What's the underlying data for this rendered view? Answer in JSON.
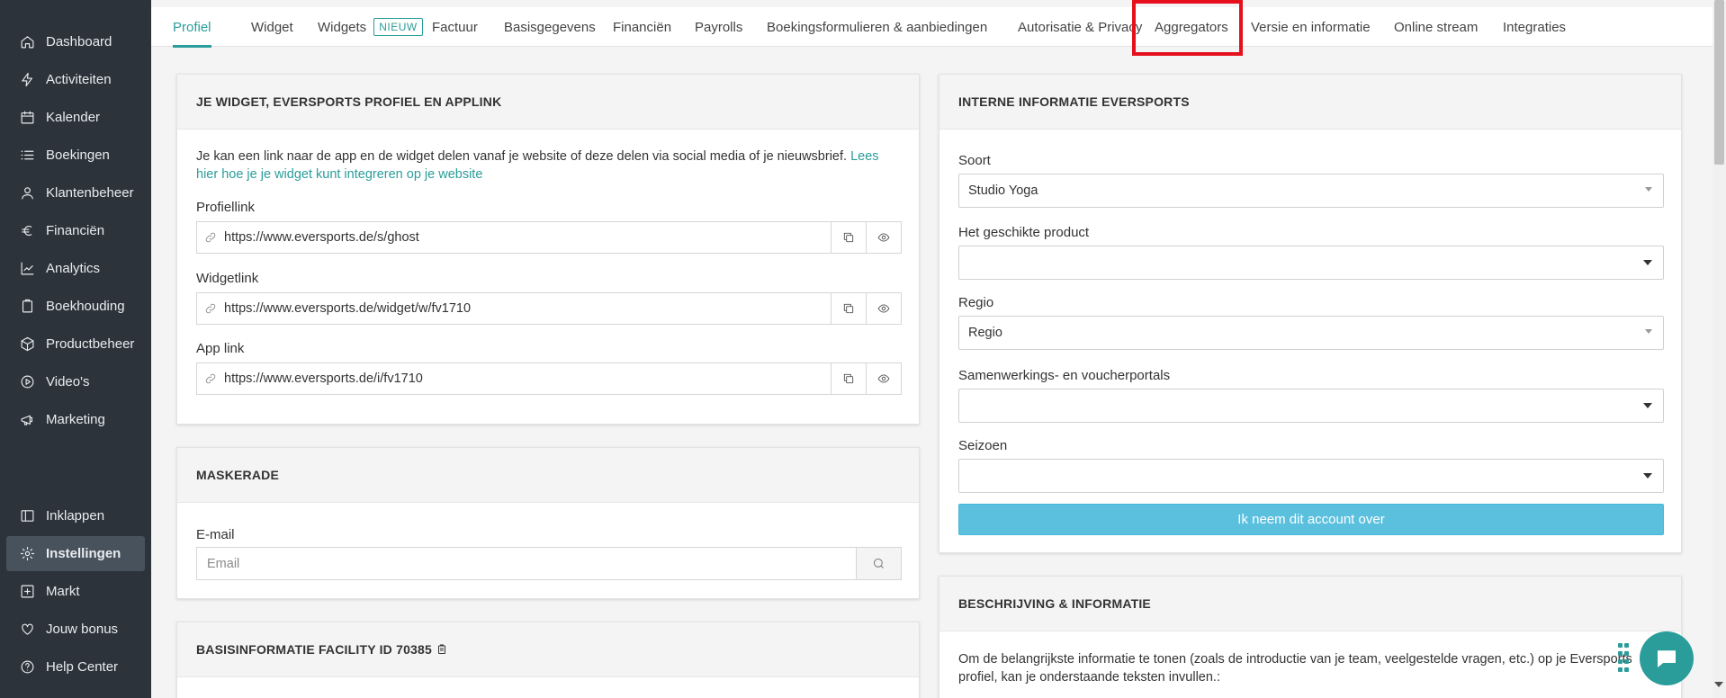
{
  "sidebar": {
    "items": [
      {
        "label": "Dashboard",
        "icon": "home-icon"
      },
      {
        "label": "Activiteiten",
        "icon": "bolt-icon"
      },
      {
        "label": "Kalender",
        "icon": "calendar-icon"
      },
      {
        "label": "Boekingen",
        "icon": "list-icon"
      },
      {
        "label": "Klantenbeheer",
        "icon": "user-icon"
      },
      {
        "label": "Financiën",
        "icon": "euro-icon"
      },
      {
        "label": "Analytics",
        "icon": "chart-line-icon"
      },
      {
        "label": "Boekhouding",
        "icon": "clipboard-icon"
      },
      {
        "label": "Productbeheer",
        "icon": "box-icon"
      },
      {
        "label": "Video's",
        "icon": "play-circle-icon"
      },
      {
        "label": "Marketing",
        "icon": "megaphone-icon"
      }
    ],
    "bottom_items": [
      {
        "label": "Inklappen",
        "icon": "collapse-icon"
      },
      {
        "label": "Instellingen",
        "icon": "gear-icon",
        "active": true
      },
      {
        "label": "Markt",
        "icon": "plus-square-icon"
      },
      {
        "label": "Jouw bonus",
        "icon": "heart-icon"
      },
      {
        "label": "Help Center",
        "icon": "help-circle-icon"
      }
    ]
  },
  "tabs": [
    {
      "label": "Profiel",
      "active": true
    },
    {
      "label": "Widget"
    },
    {
      "label": "Widgets",
      "badge": "NIEUW"
    },
    {
      "label": "Factuur"
    },
    {
      "label": "Basisgegevens"
    },
    {
      "label": "Financiën"
    },
    {
      "label": "Payrolls"
    },
    {
      "label": "Boekingsformulieren & aanbiedingen"
    },
    {
      "label": "Autorisatie & Privacy"
    },
    {
      "label": "Aggregators",
      "highlighted": true
    },
    {
      "label": "Versie en informatie"
    },
    {
      "label": "Online stream"
    },
    {
      "label": "Integraties"
    }
  ],
  "widget_card": {
    "title": "JE WIDGET, EVERSPORTS PROFIEL EN APPLINK",
    "description": "Je kan een link naar de app en de widget delen vanaf je website of deze delen via social media of je nieuwsbrief.",
    "description_link_part1": "Lees",
    "description_link_part2": "hier hoe je je widget kunt integreren op je website",
    "profile_label": "Profiellink",
    "profile_url": "https://www.eversports.de/s/ghost",
    "widget_label": "Widgetlink",
    "widget_url": "https://www.eversports.de/widget/w/fv1710",
    "app_label": "App link",
    "app_url": "https://www.eversports.de/i/fv1710"
  },
  "masquerade_card": {
    "title": "MASKERADE",
    "email_label": "E-mail",
    "email_placeholder": "Email"
  },
  "basic_info_card": {
    "title": "BASISINFORMATIE FACILITY ID 70385"
  },
  "internal_card": {
    "title": "INTERNE INFORMATIE EVERSPORTS",
    "type_label": "Soort",
    "type_value": "Studio Yoga",
    "product_label": "Het geschikte product",
    "product_value": "",
    "region_label": "Regio",
    "region_value": "Regio",
    "portals_label": "Samenwerkings- en voucherportals",
    "portals_value": "",
    "season_label": "Seizoen",
    "season_value": "",
    "takeover_button": "Ik neem dit account over"
  },
  "description_card": {
    "title": "BESCHRIJVING & INFORMATIE",
    "line1": "Om de belangrijkste informatie te tonen (zoals de introductie van je team, veelgestelde vragen, etc.) op je Eversports",
    "line2": "profiel, kan je onderstaande teksten invullen.:"
  },
  "colors": {
    "accent": "#2a9d9a",
    "sidebar_bg": "#2c333b",
    "highlight": "#e5101b",
    "primary_button": "#5bc0de"
  }
}
